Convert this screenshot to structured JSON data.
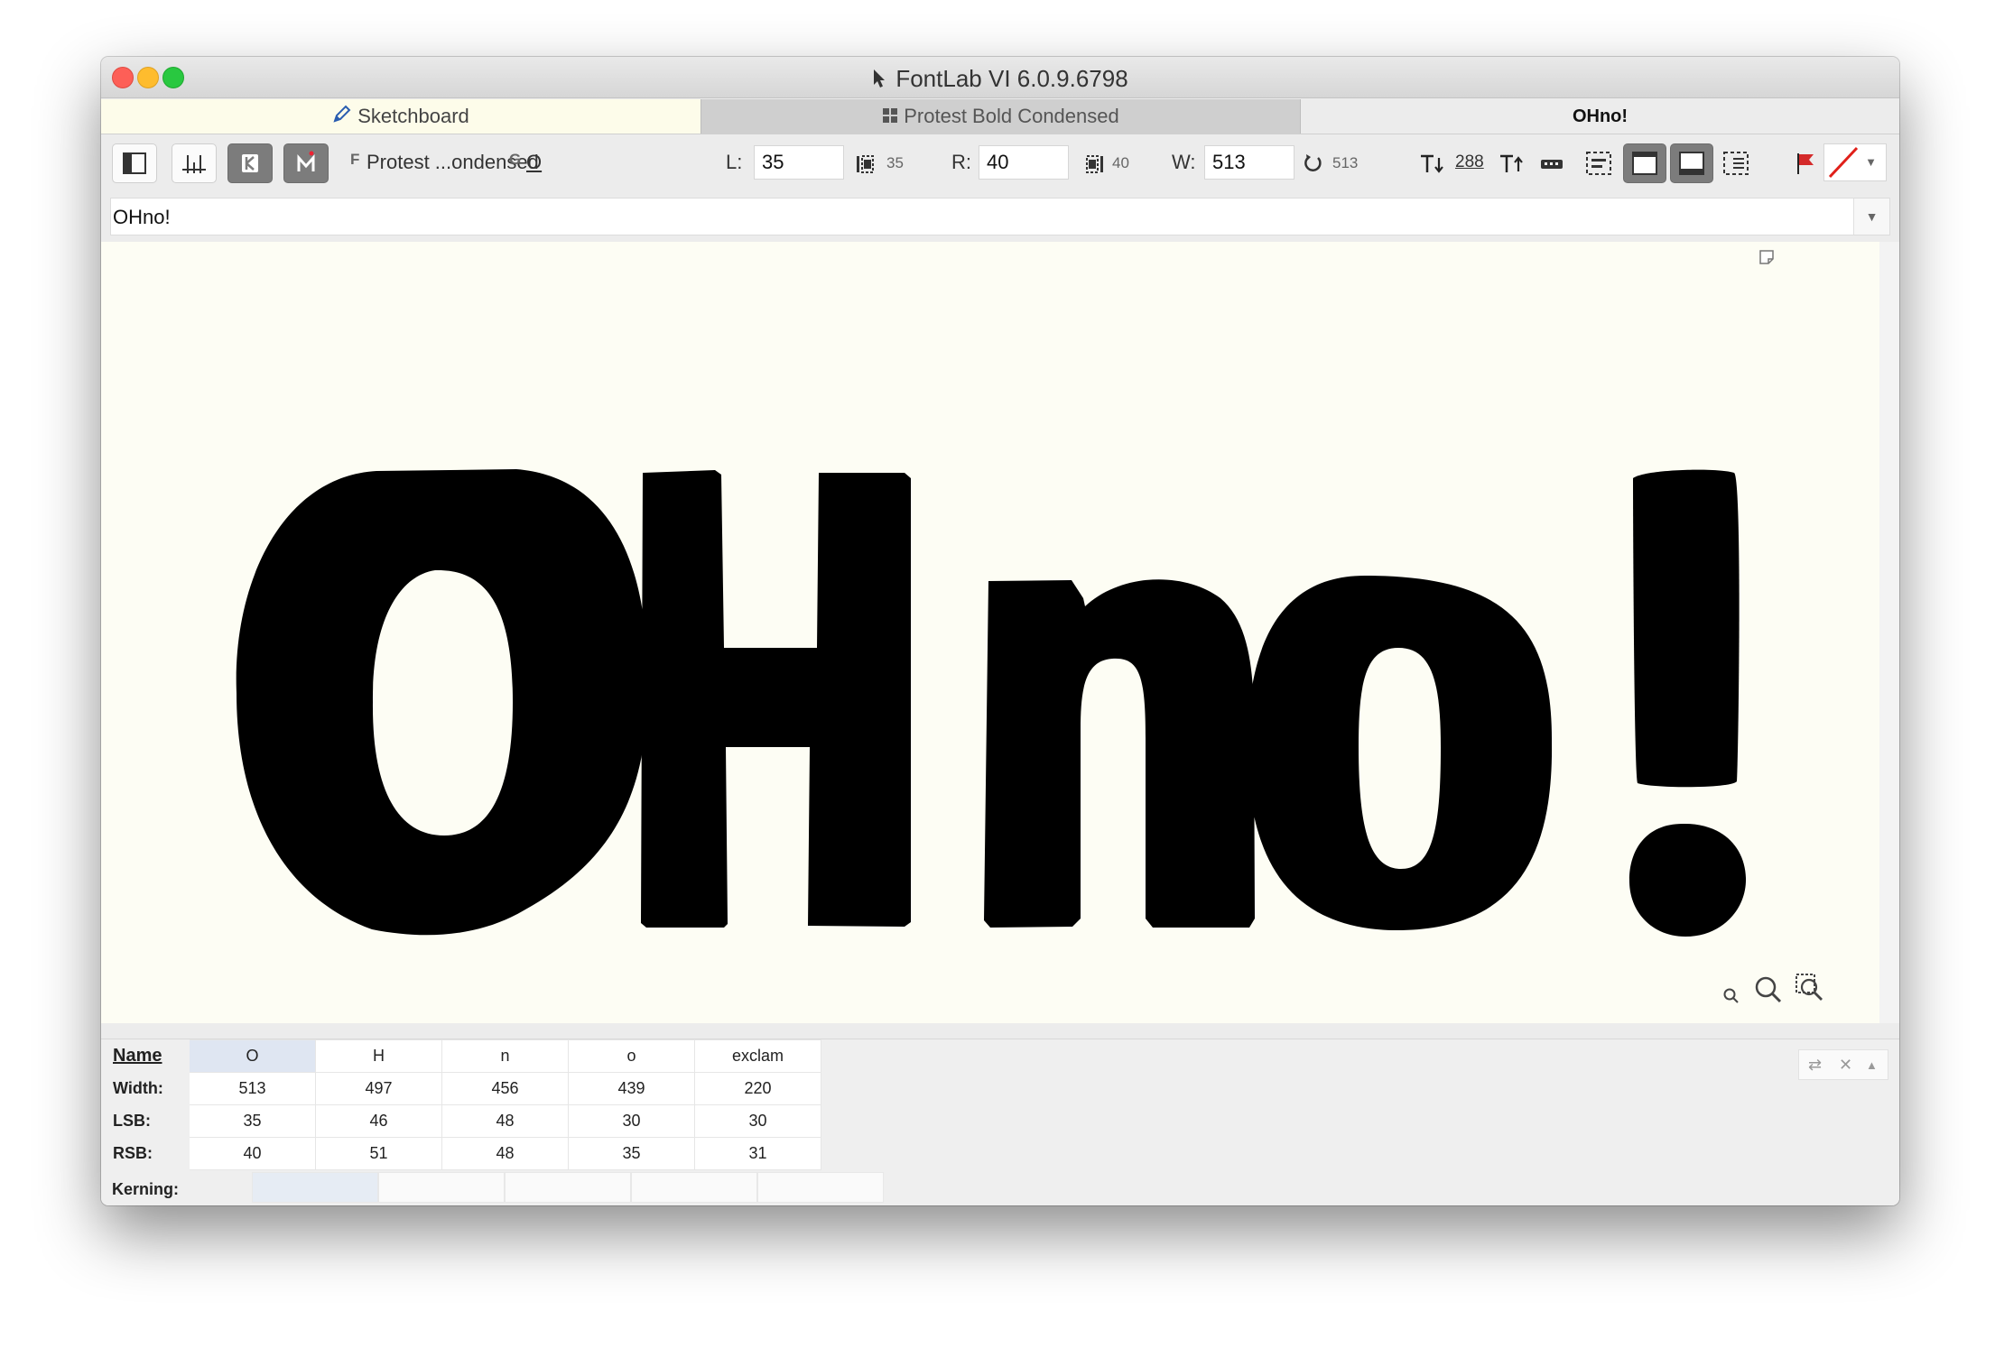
{
  "window": {
    "title": "FontLab VI 6.0.9.6798"
  },
  "tabs": [
    {
      "label": "Sketchboard",
      "icon": "pencil-icon"
    },
    {
      "label": "Protest Bold Condensed",
      "icon": "grid-icon"
    },
    {
      "label": "OHno!"
    }
  ],
  "toolbar": {
    "font_prefix": "F",
    "font_name": "Protest ...ondensed",
    "glyph_prefix": "G",
    "glyph_name": "O",
    "lsb_label": "L:",
    "lsb_value": "35",
    "lsb_readout": "35",
    "rsb_label": "R:",
    "rsb_value": "40",
    "rsb_readout": "40",
    "width_label": "W:",
    "width_value": "513",
    "width_readout": "513",
    "size_value": "288",
    "colors": {
      "flag": "#d42a2a",
      "slash": "#e0201a"
    }
  },
  "text_bar": {
    "value": "OHno!"
  },
  "canvas": {
    "text": "OHno!"
  },
  "metrics_table": {
    "row_labels": {
      "name": "Name",
      "width": "Width:",
      "lsb": "LSB:",
      "rsb": "RSB:",
      "kerning": "Kerning:"
    },
    "columns": [
      {
        "name": "O",
        "width": "513",
        "lsb": "35",
        "rsb": "40",
        "selected": true
      },
      {
        "name": "H",
        "width": "497",
        "lsb": "46",
        "rsb": "51"
      },
      {
        "name": "n",
        "width": "456",
        "lsb": "48",
        "rsb": "48"
      },
      {
        "name": "o",
        "width": "439",
        "lsb": "30",
        "rsb": "35"
      },
      {
        "name": "exclam",
        "width": "220",
        "lsb": "30",
        "rsb": "31"
      }
    ]
  }
}
